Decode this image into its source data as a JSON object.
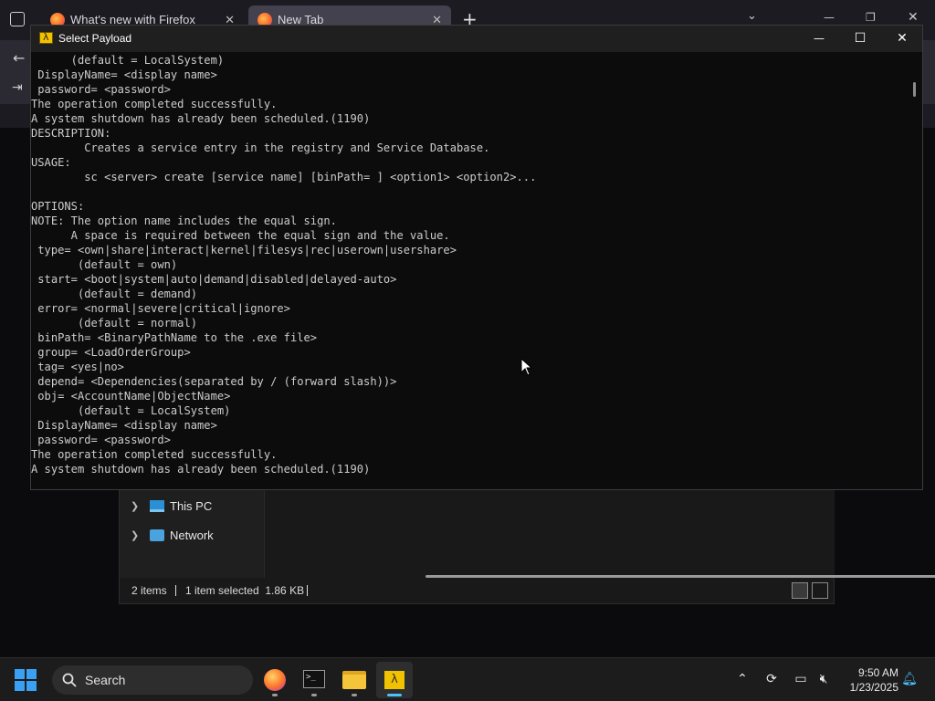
{
  "firefox": {
    "tabs": [
      {
        "title": "What's new with Firefox"
      },
      {
        "title": "New Tab"
      }
    ],
    "new_tab_symbol": "+",
    "close_symbol": "✕"
  },
  "console": {
    "title": "Select Payload",
    "minimize_symbol": "—",
    "maximize_symbol": "☐",
    "close_symbol": "✕",
    "lines": [
      "      (default = LocalSystem)",
      " DisplayName= <display name>",
      " password= <password>",
      "The operation completed successfully.",
      "A system shutdown has already been scheduled.(1190)",
      "DESCRIPTION:",
      "        Creates a service entry in the registry and Service Database.",
      "USAGE:",
      "        sc <server> create [service name] [binPath= ] <option1> <option2>...",
      "",
      "OPTIONS:",
      "NOTE: The option name includes the equal sign.",
      "      A space is required between the equal sign and the value.",
      " type= <own|share|interact|kernel|filesys|rec|userown|usershare>",
      "       (default = own)",
      " start= <boot|system|auto|demand|disabled|delayed-auto>",
      "       (default = demand)",
      " error= <normal|severe|critical|ignore>",
      "       (default = normal)",
      " binPath= <BinaryPathName to the .exe file>",
      " group= <LoadOrderGroup>",
      " tag= <yes|no>",
      " depend= <Dependencies(separated by / (forward slash))>",
      " obj= <AccountName|ObjectName>",
      "       (default = LocalSystem)",
      " DisplayName= <display name>",
      " password= <password>",
      "The operation completed successfully.",
      "A system shutdown has already been scheduled.(1190)"
    ]
  },
  "explorer": {
    "nav": [
      {
        "label": "This PC",
        "icon": "computer-icon"
      },
      {
        "label": "Network",
        "icon": "network-icon"
      }
    ],
    "status": {
      "items": "2 items",
      "selected": "1 item selected  1.86 KB"
    }
  },
  "taskbar": {
    "search_label": "Search",
    "apps": [
      "firefox-icon",
      "terminal-icon",
      "file-explorer-icon",
      "payload-app-icon"
    ],
    "clock_time": "9:50 AM",
    "clock_date": "1/23/2025"
  },
  "colors": {
    "console_bg": "#0c0c0c",
    "console_text": "#cccccc",
    "accent": "#4cc2ff"
  }
}
